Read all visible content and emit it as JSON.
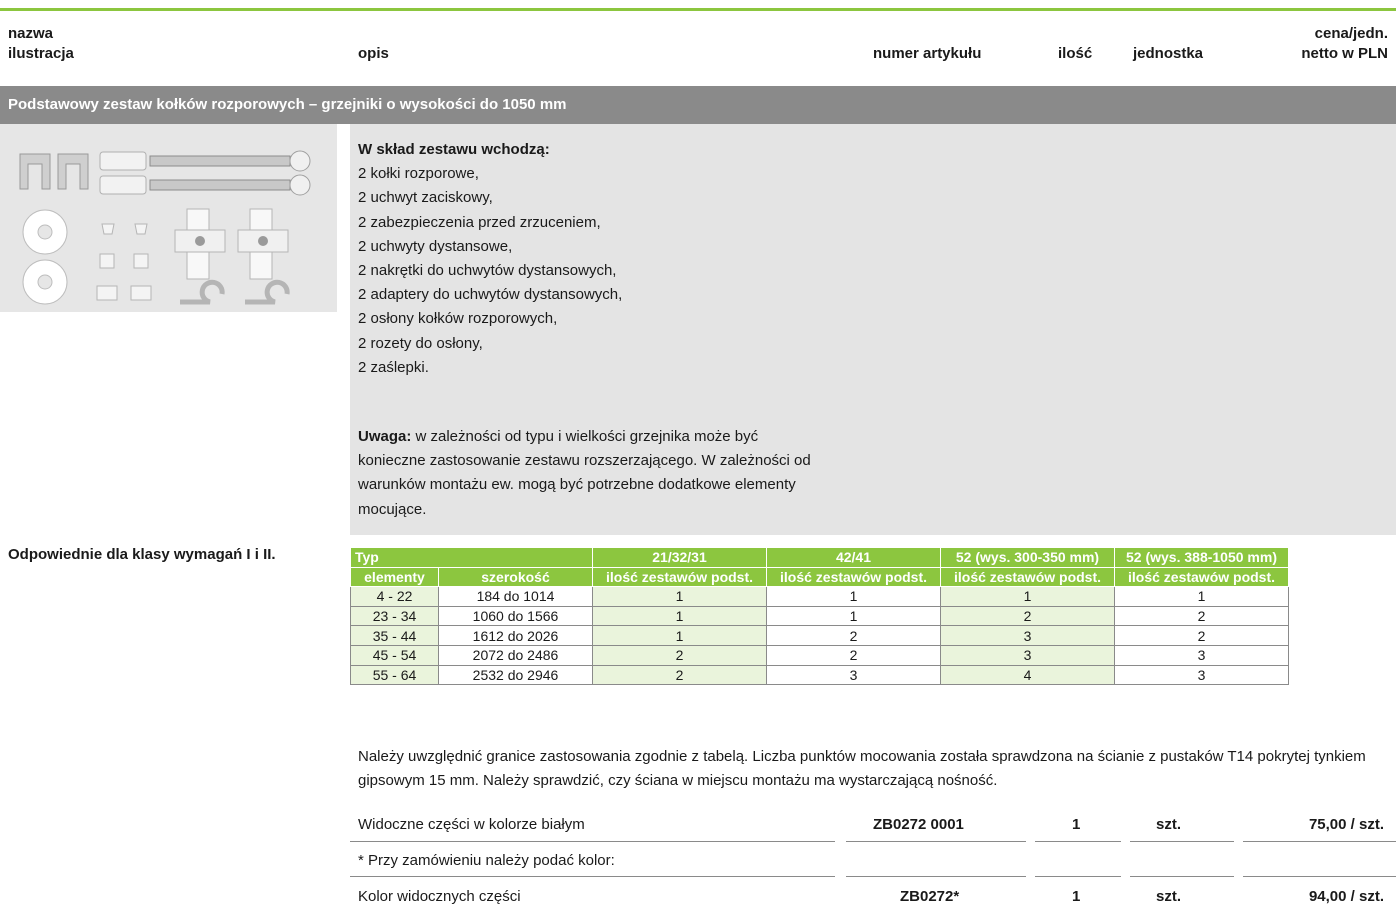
{
  "header": {
    "col1_line1": "nazwa",
    "col1_line2": "ilustracja",
    "col2": "opis",
    "col3": "numer artykułu",
    "col4": "ilość",
    "col5": "jednostka",
    "col6_line1": "cena/jedn.",
    "col6_line2": "netto w PLN"
  },
  "section_title": "Podstawowy zestaw kołków rozporowych – grzejniki o wysokości do 1050 mm",
  "kit": {
    "heading": "W skład zestawu wchodzą:",
    "items": [
      "2 kołki rozporowe,",
      "2 uchwyt zaciskowy,",
      "2 zabezpieczenia przed zrzuceniem,",
      "2 uchwyty dystansowe,",
      "2 nakrętki do uchwytów dystansowych,",
      "2 adaptery do uchwytów dystansowych,",
      "2 osłony kołków rozporowych,",
      "2 rozety do osłony,",
      "2 zaślepki."
    ]
  },
  "note": {
    "label": "Uwaga:",
    "text": " w zależności od typu i wielkości grzejnika może być konieczne zastosowanie zestawu rozszerzającego. W zależności od warunków montażu ew. mogą być potrzebne dodatkowe elementy mocujące."
  },
  "suitable": "Odpowiednie dla klasy wymagań I i II.",
  "table": {
    "type_label": "Typ",
    "types": [
      "21/32/31",
      "42/41",
      "52 (wys. 300-350 mm)",
      "52 (wys. 388-1050 mm)"
    ],
    "sub_headers": [
      "elementy",
      "szerokość",
      "ilość zestawów podst.",
      "ilość zestawów podst.",
      "ilość zestawów podst.",
      "ilość zestawów podst."
    ],
    "rows": [
      [
        "4 - 22",
        "184 do 1014",
        "1",
        "1",
        "1",
        "1"
      ],
      [
        "23 - 34",
        "1060 do 1566",
        "1",
        "1",
        "2",
        "2"
      ],
      [
        "35 - 44",
        "1612 do 2026",
        "1",
        "2",
        "3",
        "2"
      ],
      [
        "45 - 54",
        "2072 do 2486",
        "2",
        "2",
        "3",
        "3"
      ],
      [
        "55 - 64",
        "2532 do 2946",
        "2",
        "3",
        "4",
        "3"
      ]
    ]
  },
  "bottom_note": "Należy uwzględnić granice zastosowania zgodnie z tabelą. Liczba punktów mocowania została sprawdzona na ścianie z pustaków T14 pokrytej tynkiem gipsowym 15 mm. Należy sprawdzić, czy ściana w miejscu montażu ma wystarczającą nośność.",
  "orders": [
    {
      "desc": "Widoczne części w kolorze białym",
      "article": "ZB0272 0001",
      "qty": "1",
      "unit": "szt.",
      "price": "75,00 / szt."
    },
    {
      "desc": "* Przy zamówieniu należy podać kolor:",
      "article": "",
      "qty": "",
      "unit": "",
      "price": ""
    },
    {
      "desc": "Kolor widocznych części",
      "article": "ZB0272*",
      "qty": "1",
      "unit": "szt.",
      "price": "94,00 / szt."
    }
  ],
  "colors": {
    "accent": "#8cc63f",
    "section_bg": "#8a8a8a",
    "box_bg": "#e4e4e4"
  }
}
